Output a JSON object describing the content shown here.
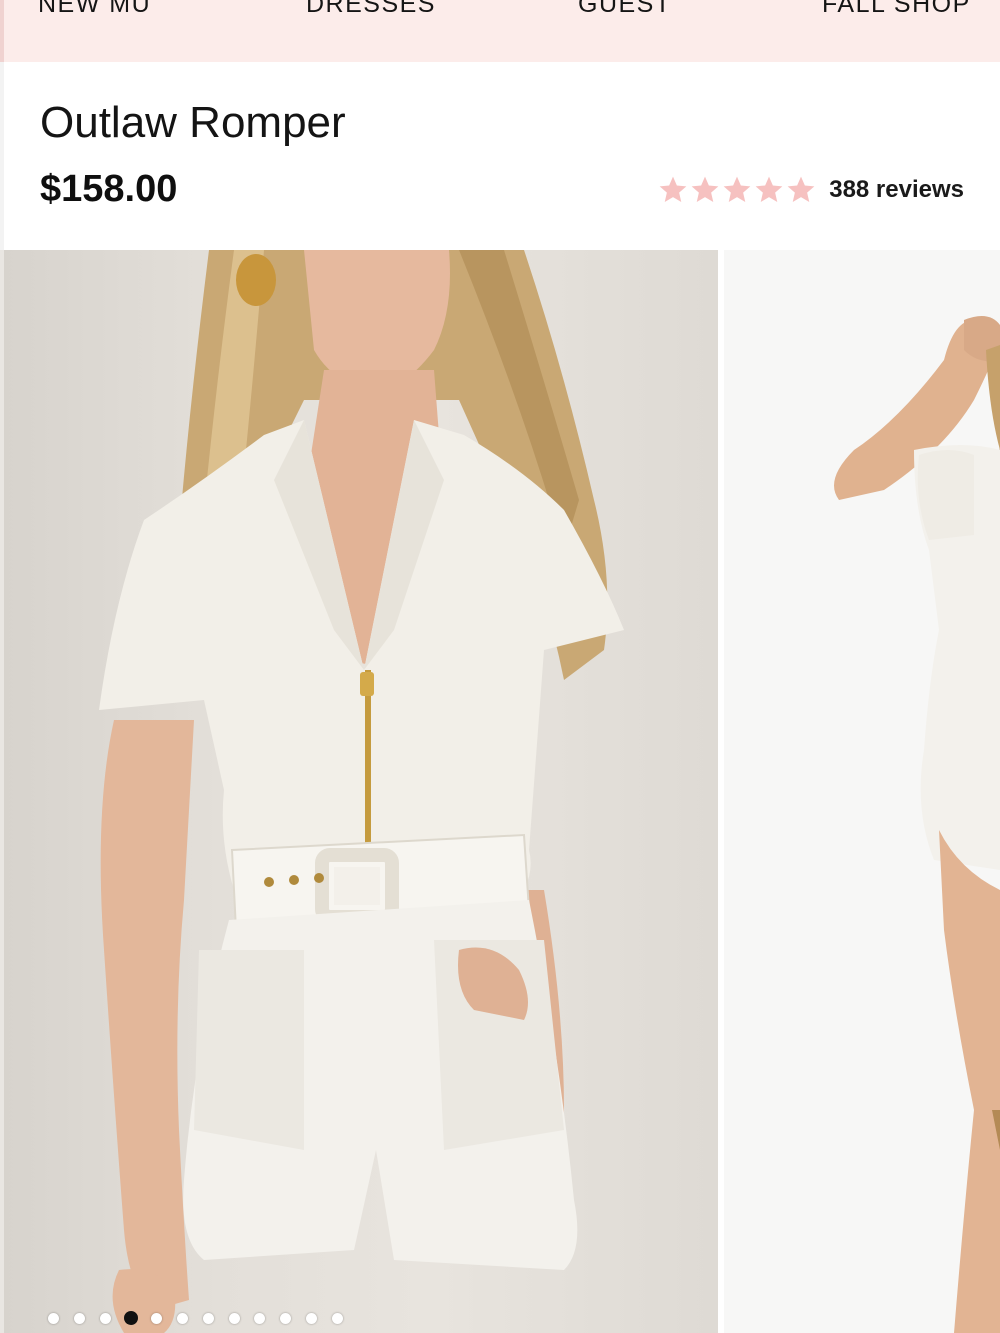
{
  "nav": {
    "items": [
      {
        "label": "NEW MU"
      },
      {
        "label": "DRESSES"
      },
      {
        "label": "GUEST"
      },
      {
        "label": "FALL SHOP"
      }
    ]
  },
  "product": {
    "title": "Outlaw Romper",
    "price": "$158.00",
    "rating": {
      "stars": 5,
      "reviews_label": "388 reviews",
      "star_color": "#f6c1c0"
    }
  },
  "gallery": {
    "slide_count": 12,
    "active_index": 3
  },
  "colors": {
    "nav_background": "#fcecea",
    "accent_pink": "#f6c1c0"
  }
}
